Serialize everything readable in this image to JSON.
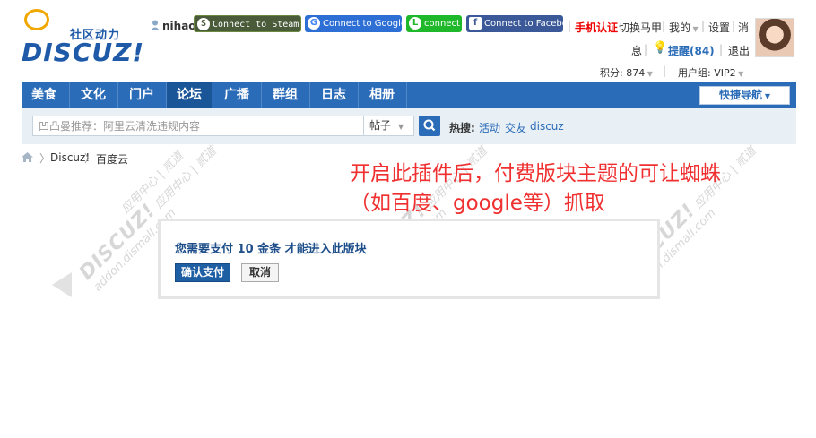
{
  "logo": {
    "tagline": "社区动力",
    "wordmark": "DISCUZ!"
  },
  "user": {
    "name": "nihao"
  },
  "social": {
    "steam": "Connect to Steam",
    "google": "Connect to Google",
    "line": "connect",
    "facebook": "Connect to Facebook"
  },
  "toplinks": {
    "phone_cert": "手机认证",
    "switch": "切换马甲",
    "mine": "我的",
    "settings": "设置",
    "msg_1": "消",
    "msg_2": "息",
    "remind": "提醒(84)",
    "logout": "退出",
    "points": "积分: 874",
    "group": "用户组: VIP2"
  },
  "nav": {
    "items": [
      "美食",
      "文化",
      "门户",
      "论坛",
      "广播",
      "群组",
      "日志",
      "相册"
    ],
    "active": "论坛",
    "quick_nav": "快捷导航"
  },
  "search": {
    "placeholder": "凹凸曼推荐：阿里云清洗违规内容",
    "type": "帖子",
    "hot_label": "热搜:",
    "hot": [
      "活动",
      "交友",
      "discuz"
    ]
  },
  "breadcrumb": [
    "Discuz!",
    "百度云"
  ],
  "annotation": {
    "line1": "开启此插件后，付费版块主题的可让蜘蛛",
    "line2": "（如百度、google等）抓取"
  },
  "watermark": {
    "brand": "DISCUZ!",
    "text": "应用中心 | 贰道",
    "url": "addon.dismall.com"
  },
  "payment": {
    "message": "您需要支付 10 金条 才能进入此版块",
    "confirm": "确认支付",
    "cancel": "取消"
  },
  "colors": {
    "accent": "#2b6cb8",
    "annotation": "#f03030",
    "nav_active": "#1a5598"
  }
}
